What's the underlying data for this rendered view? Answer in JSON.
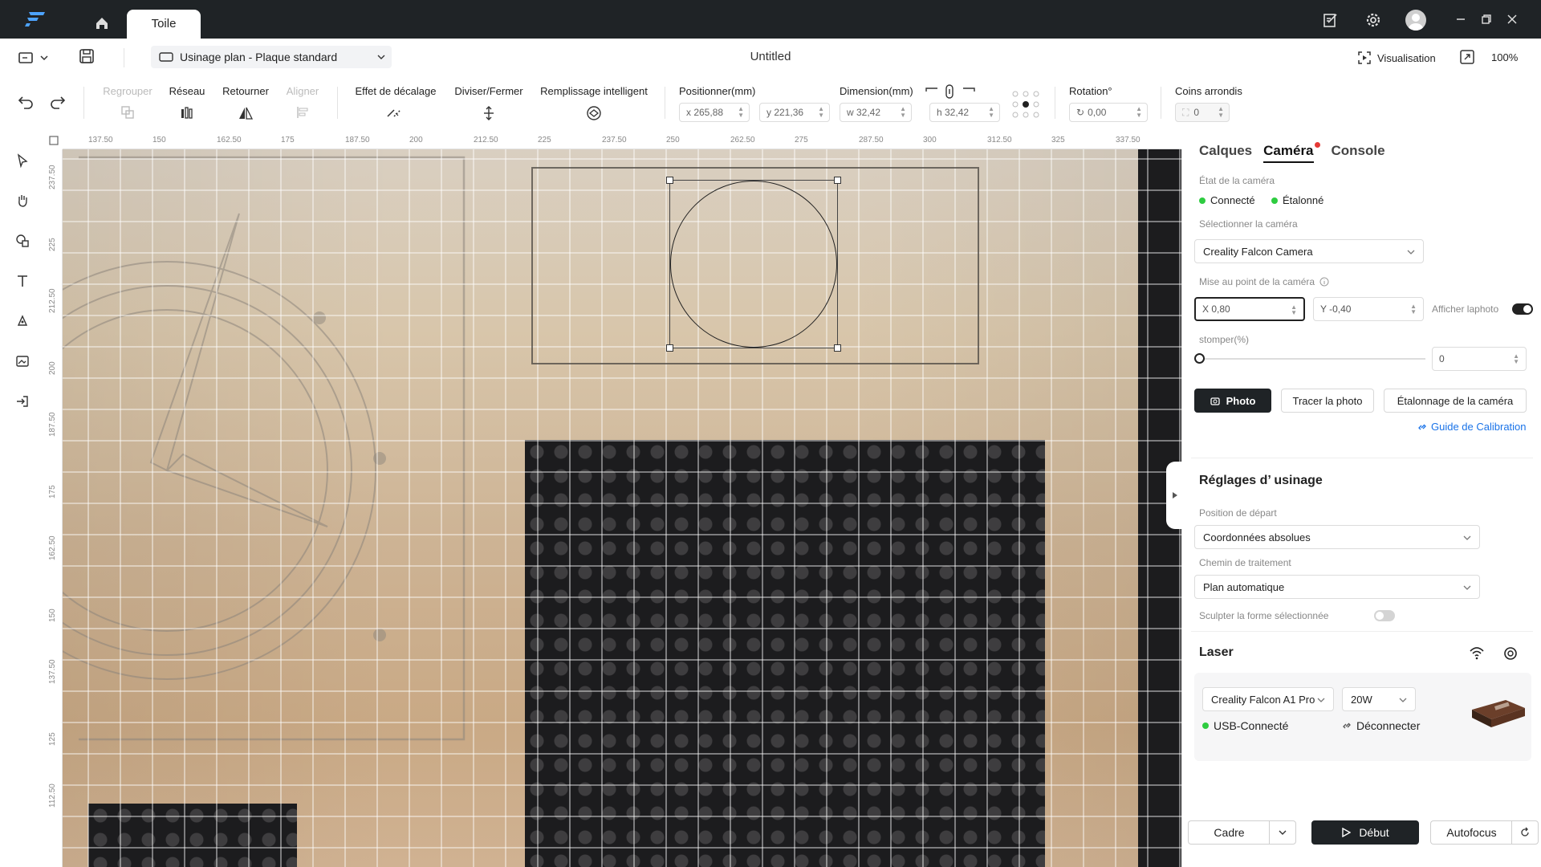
{
  "titlebar": {
    "tab_label": "Toile"
  },
  "toolbar": {
    "mode_select": "Usinage plan - Plaque standard",
    "doc_title": "Untitled",
    "visualisation": "Visualisation",
    "zoom": "100%"
  },
  "tools": {
    "regrouper": "Regrouper",
    "reseau": "Réseau",
    "retourner": "Retourner",
    "aligner": "Aligner",
    "effet_decalage": "Effet de décalage",
    "diviser_fermer": "Diviser/Fermer",
    "remplissage": "Remplissage intelligent",
    "positionner": "Positionner(mm)",
    "pos_x": "x 265,88",
    "pos_y": "y 221,36",
    "dimension": "Dimension(mm)",
    "dim_w": "w 32,42",
    "dim_h": "h 32,42",
    "rotation": "Rotation°",
    "rotation_val": "0,00",
    "coins": "Coins arrondis",
    "coins_val": "0"
  },
  "rulers": {
    "h_labels": [
      "137.50",
      "150",
      "162.50",
      "175",
      "187.50",
      "200",
      "212.50",
      "225",
      "237.50",
      "250",
      "262.50",
      "275",
      "287.50",
      "300",
      "312.50",
      "325",
      "337.50"
    ],
    "v_labels": [
      "237.50",
      "225",
      "212.50",
      "200",
      "187.50",
      "175",
      "162.50",
      "150",
      "137.50",
      "125",
      "112.50"
    ]
  },
  "panel": {
    "tabs": [
      "Calques",
      "Caméra",
      "Console"
    ],
    "etat_label": "État de la caméra",
    "connecte": "Connecté",
    "etalonne": "Étalonné",
    "select_cam_label": "Sélectionner la caméra",
    "camera": "Creality Falcon Camera",
    "focus_label": "Mise au point de la caméra",
    "x_val": "X 0,80",
    "y_val": "Y -0,40",
    "afficher": "Afficher laphoto",
    "estomper": "stomper(%)",
    "estomper_val": "0",
    "photo_btn": "Photo",
    "tracer_btn": "Tracer la photo",
    "etalonnage_btn": "Étalonnage de la caméra",
    "guide": "Guide de Calibration",
    "reglages_title": "Réglages d’ usinage",
    "depart_label": "Position de départ",
    "depart_val": "Coordonnées absolues",
    "chemin_label": "Chemin de traitement",
    "chemin_val": "Plan automatique",
    "sculpter": "Sculpter la forme sélectionnée",
    "laser_title": "Laser",
    "machine": "Creality Falcon A1 Pro",
    "power": "20W",
    "usb": "USB-Connecté",
    "deconnecter": "Déconnecter"
  },
  "bottom": {
    "cadre": "Cadre",
    "debut": "Début",
    "autofocus": "Autofocus"
  },
  "colors": {
    "titlebar": "#1f2326",
    "accent_dark": "#1f2326",
    "status_green": "#2ecc40",
    "link_blue": "#1a73e8",
    "notify_red": "#e53935"
  }
}
